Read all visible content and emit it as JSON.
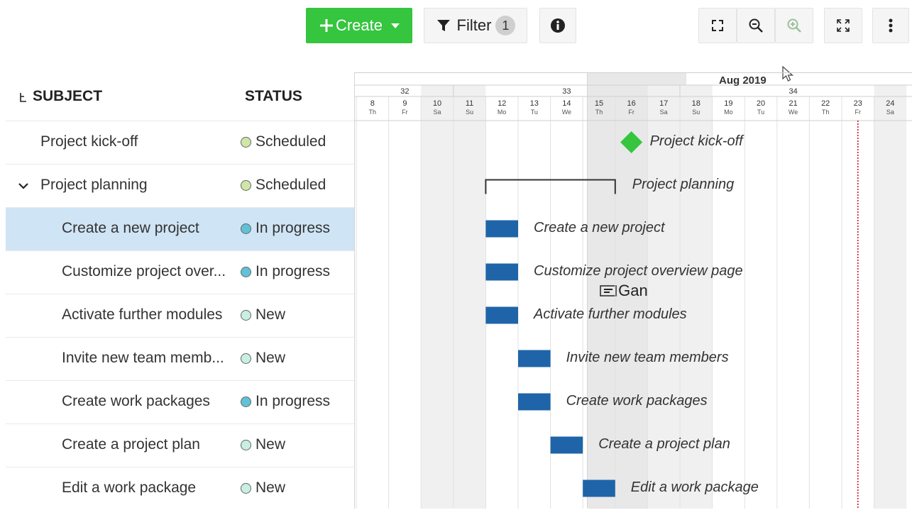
{
  "toolbar": {
    "create_label": "Create",
    "filter_label": "Filter",
    "filter_count": "1",
    "view_label": "Gantt"
  },
  "table": {
    "subject_header": "SUBJECT",
    "status_header": "STATUS",
    "rows": [
      {
        "subject": "Project kick-off",
        "status": "Scheduled",
        "status_color": "#cfe6a6"
      },
      {
        "subject": "Project planning",
        "status": "Scheduled",
        "status_color": "#cfe6a6"
      },
      {
        "subject": "Create a new project",
        "status": "In progress",
        "status_color": "#5fc2d6"
      },
      {
        "subject": "Customize project over...",
        "status": "In progress",
        "status_color": "#5fc2d6"
      },
      {
        "subject": "Activate further modules",
        "status": "New",
        "status_color": "#c8efe0"
      },
      {
        "subject": "Invite new team memb...",
        "status": "New",
        "status_color": "#c8efe0"
      },
      {
        "subject": "Create work packages",
        "status": "In progress",
        "status_color": "#5fc2d6"
      },
      {
        "subject": "Create a project plan",
        "status": "New",
        "status_color": "#c8efe0"
      },
      {
        "subject": "Edit a work package",
        "status": "New",
        "status_color": "#c8efe0"
      }
    ]
  },
  "gantt": {
    "month_label": "Aug 2019",
    "weeks": [
      "32",
      "33",
      "34"
    ],
    "days": [
      {
        "num": "8",
        "name": "Th"
      },
      {
        "num": "9",
        "name": "Fr"
      },
      {
        "num": "10",
        "name": "Sa"
      },
      {
        "num": "11",
        "name": "Su"
      },
      {
        "num": "12",
        "name": "Mo"
      },
      {
        "num": "13",
        "name": "Tu"
      },
      {
        "num": "14",
        "name": "We"
      },
      {
        "num": "15",
        "name": "Th"
      },
      {
        "num": "16",
        "name": "Fr"
      },
      {
        "num": "17",
        "name": "Sa"
      },
      {
        "num": "18",
        "name": "Su"
      },
      {
        "num": "19",
        "name": "Mo"
      },
      {
        "num": "20",
        "name": "Tu"
      },
      {
        "num": "21",
        "name": "We"
      },
      {
        "num": "22",
        "name": "Th"
      },
      {
        "num": "23",
        "name": "Fr"
      },
      {
        "num": "24",
        "name": "Sa"
      }
    ],
    "bar_color": "#1f64a8",
    "milestone_color": "#35c53f",
    "today_color": "#d0021b",
    "items": [
      {
        "label": "Project kick-off",
        "type": "milestone",
        "start": "16",
        "end": "16"
      },
      {
        "label": "Project planning",
        "type": "parent",
        "start": "12",
        "end": "15"
      },
      {
        "label": "Create a new project",
        "type": "bar",
        "start": "12",
        "end": "12"
      },
      {
        "label": "Customize project overview page",
        "type": "bar",
        "start": "12",
        "end": "12"
      },
      {
        "label": "Activate further modules",
        "type": "bar",
        "start": "12",
        "end": "12"
      },
      {
        "label": "Invite new team members",
        "type": "bar",
        "start": "13",
        "end": "13"
      },
      {
        "label": "Create work packages",
        "type": "bar",
        "start": "13",
        "end": "13"
      },
      {
        "label": "Create a project plan",
        "type": "bar",
        "start": "14",
        "end": "14"
      },
      {
        "label": "Edit a work package",
        "type": "bar",
        "start": "15",
        "end": "15"
      }
    ],
    "today": "23"
  }
}
